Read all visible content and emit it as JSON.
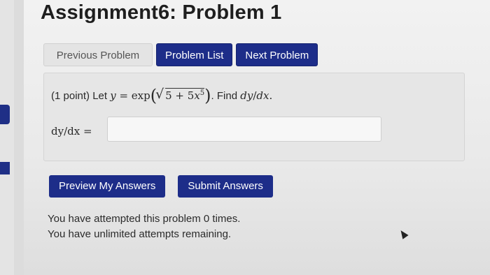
{
  "page": {
    "title": "Assignment6: Problem 1"
  },
  "nav": {
    "previous_label": "Previous Problem",
    "list_label": "Problem List",
    "next_label": "Next Problem"
  },
  "problem": {
    "points": "(1 point) Let",
    "find": ". Find",
    "answer_label": "dy/dx ="
  },
  "actions": {
    "preview_label": "Preview My Answers",
    "submit_label": "Submit Answers"
  },
  "status": {
    "attempted": "You have attempted this problem 0 times.",
    "remaining": "You have unlimited attempts remaining."
  },
  "colors": {
    "accent": "#1d2d89",
    "background": "#ececec"
  }
}
